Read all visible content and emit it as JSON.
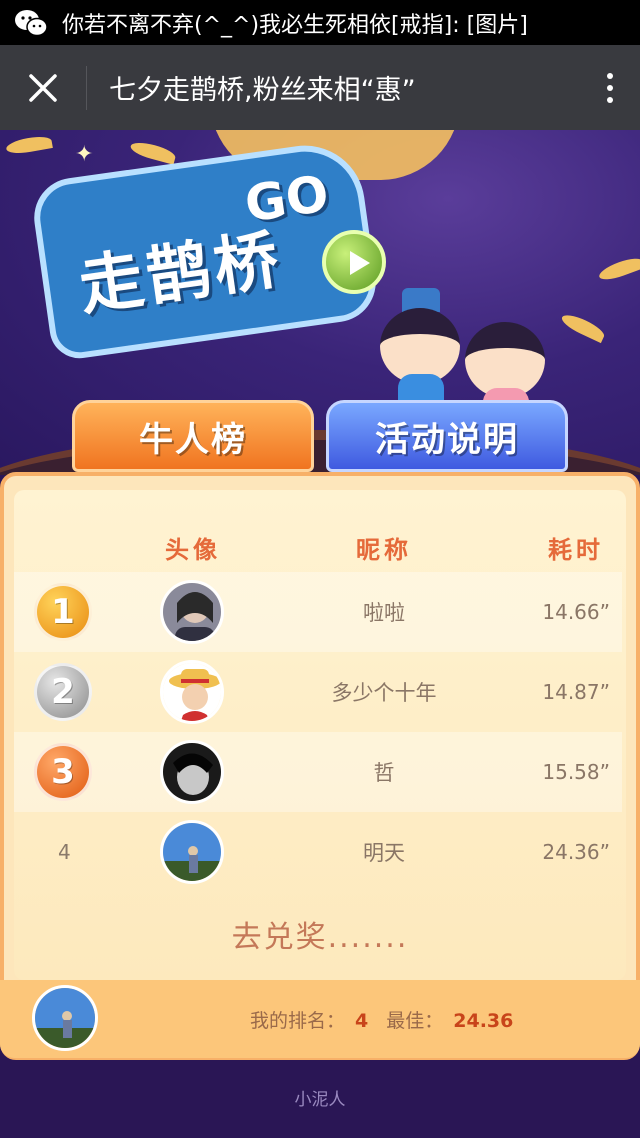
{
  "notification": {
    "text": "你若不离不弃(^_^)我必生死相依[戒指]: [图片]",
    "icon": "wechat-icon"
  },
  "titlebar": {
    "title": "七夕走鹊桥,粉丝来相“惠”",
    "close_icon": "close-icon",
    "more_icon": "more-vertical-icon"
  },
  "hero": {
    "logo_text": "走鹊桥",
    "logo_go": "GO"
  },
  "tabs": {
    "rank": "牛人榜",
    "info": "活动说明"
  },
  "table": {
    "headers": {
      "avatar": "头像",
      "nickname": "昵称",
      "time": "耗时"
    },
    "rows": [
      {
        "rank": "1",
        "nickname": "啦啦",
        "time": "14.66”"
      },
      {
        "rank": "2",
        "nickname": "多少个十年",
        "time": "14.87”"
      },
      {
        "rank": "3",
        "nickname": "哲",
        "time": "15.58”"
      },
      {
        "rank": "4",
        "nickname": "明天",
        "time": "24.36”"
      }
    ]
  },
  "redeem_label": "去兑奖.......",
  "my": {
    "rank_label": "我的排名：",
    "rank_value": "4",
    "best_label": "最佳：",
    "best_value": "24.36"
  },
  "footer": "小泥人",
  "colors": {
    "accent": "#e56a3a",
    "title_bar": "#393a3f",
    "card": "#fde6bb"
  }
}
